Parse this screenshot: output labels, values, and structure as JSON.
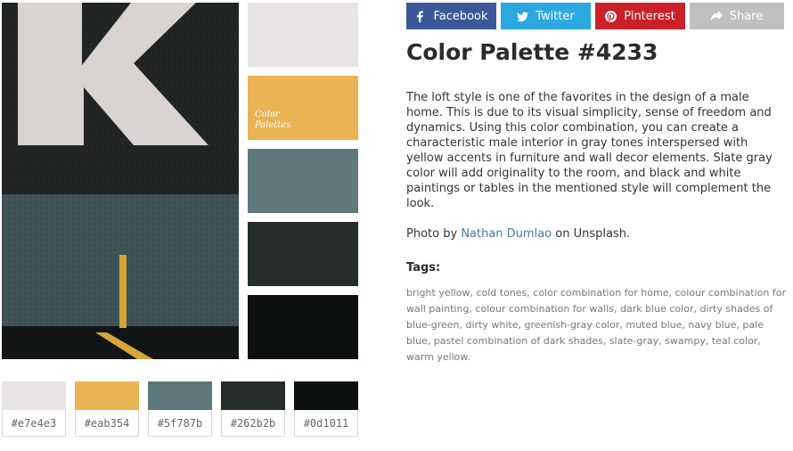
{
  "palette_title": "Color Palette #4233",
  "share": {
    "facebook": "Facebook",
    "twitter": "Twitter",
    "pinterest": "Pinterest",
    "share": "Share"
  },
  "share_colors": {
    "facebook": "#3b5998",
    "twitter": "#2ca7e0",
    "pinterest": "#cb2027",
    "share": "#c0c0c0"
  },
  "brand_mark": [
    "Color",
    "Palettes"
  ],
  "description": "The loft style is one of the favorites in the design of a male home. This is due to its visual simplicity, sense of freedom and dynamics. Using this color combination, you can create a characteristic male interior in gray tones interspersed with yellow accents in furniture and wall decor elements. Slate gray color will add originality to the room, and black and white paintings or tables in the mentioned style will complement the look.",
  "credit": {
    "prefix": "Photo by",
    "author": "Nathan Dumlao",
    "suffix": "on Unsplash."
  },
  "tags_label": "Tags:",
  "tags": [
    "bright yellow",
    "cold tones",
    "color combination for home",
    "colour combination for wall painting",
    "colour combination for walls",
    "dark blue color",
    "dirty shades of blue-green",
    "dirty white",
    "greenish-gray color",
    "muted blue",
    "navy blue",
    "pale blue",
    "pastel combination of dark shades",
    "slate-gray",
    "swampy",
    "teal color",
    "warm yellow"
  ],
  "colors": [
    "#e7e4e3",
    "#eab354",
    "#5f787b",
    "#262b2b",
    "#0d1011"
  ],
  "hex_labels": [
    "#e7e4e3",
    "#eab354",
    "#5f787b",
    "#262b2b",
    "#0d1011"
  ]
}
